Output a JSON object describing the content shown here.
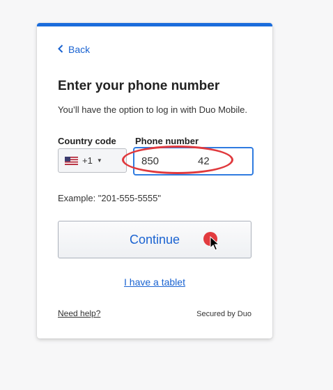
{
  "back_label": "Back",
  "title": "Enter your phone number",
  "subtitle": "You’ll have the option to log in with Duo Mobile.",
  "country_code": {
    "label": "Country code",
    "selected": "+1",
    "flag_icon": "us-flag-icon"
  },
  "phone": {
    "label": "Phone number",
    "value_start": "850",
    "value_end": "42"
  },
  "example": "Example: \"201-555-5555\"",
  "continue_label": "Continue",
  "tablet_label": "I have a tablet",
  "help_label": "Need help?",
  "secured_label": "Secured by Duo",
  "colors": {
    "accent": "#1a6cdc",
    "link": "#1a63d1",
    "annotation": "#e0393d"
  }
}
